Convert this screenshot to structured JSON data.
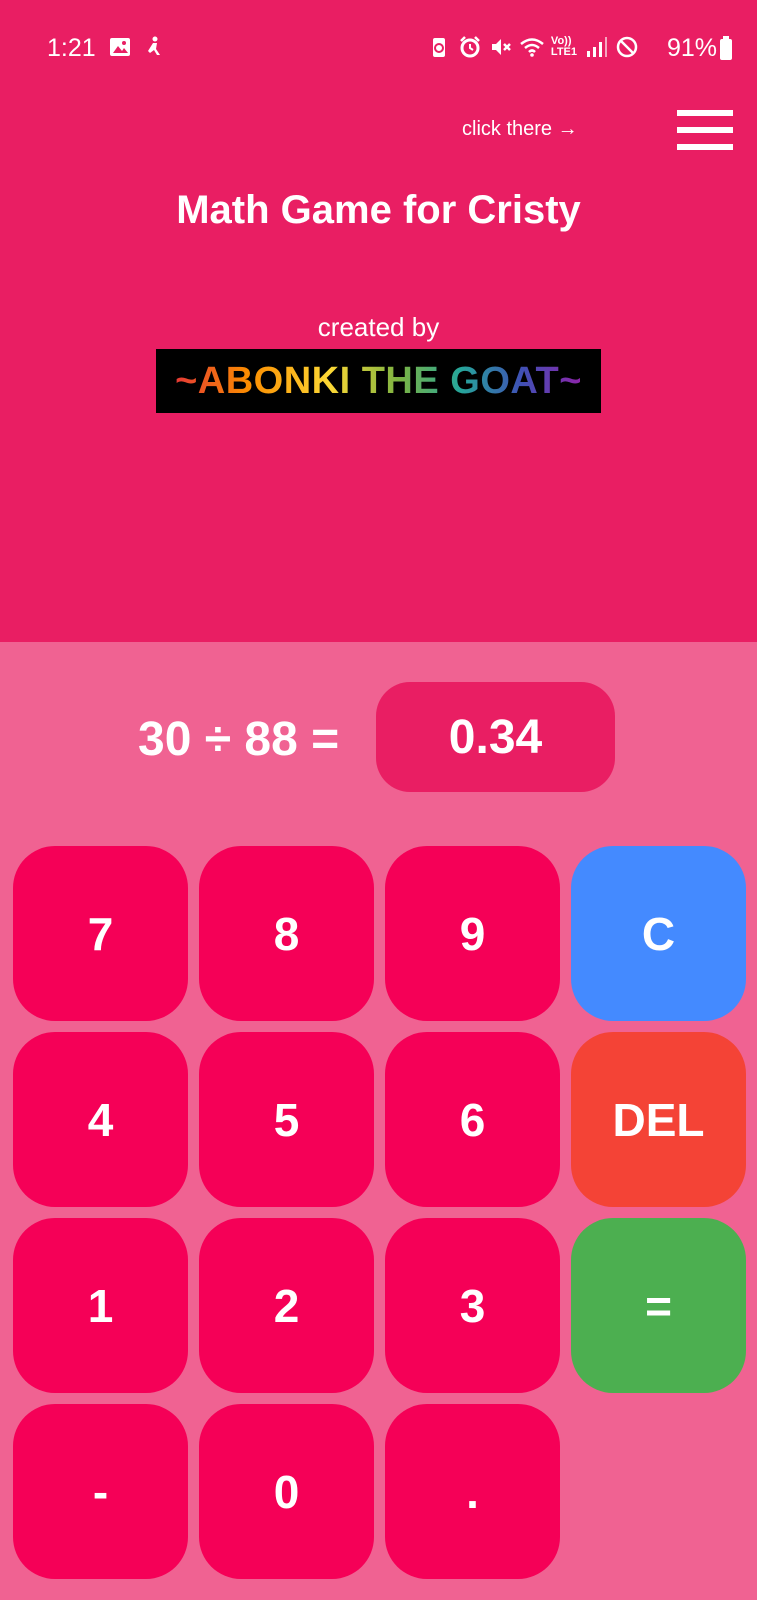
{
  "status_bar": {
    "time": "1:21",
    "battery": "91%",
    "left_icons": [
      "gallery-icon",
      "accessibility-icon"
    ],
    "right_icons": [
      "battery-saver-icon",
      "alarm-icon",
      "mute-icon",
      "wifi-icon",
      "volte-icon",
      "signal-icon",
      "dnd-icon"
    ],
    "volte_label": "Vo))",
    "lte_label": "LTE1"
  },
  "header": {
    "hint": "click there →",
    "menu_icon": "hamburger-menu-icon",
    "title": "Math Game for Cristy",
    "created_by": "created by",
    "author": "~ABONKI THE GOAT~"
  },
  "question": {
    "text": "30 ÷ 88 =",
    "answer": "0.34"
  },
  "keypad": {
    "keys": [
      {
        "label": "7",
        "kind": "digit"
      },
      {
        "label": "8",
        "kind": "digit"
      },
      {
        "label": "9",
        "kind": "digit"
      },
      {
        "label": "C",
        "kind": "clear"
      },
      {
        "label": "4",
        "kind": "digit"
      },
      {
        "label": "5",
        "kind": "digit"
      },
      {
        "label": "6",
        "kind": "digit"
      },
      {
        "label": "DEL",
        "kind": "del"
      },
      {
        "label": "1",
        "kind": "digit"
      },
      {
        "label": "2",
        "kind": "digit"
      },
      {
        "label": "3",
        "kind": "digit"
      },
      {
        "label": "=",
        "kind": "eq"
      },
      {
        "label": "-",
        "kind": "digit"
      },
      {
        "label": "0",
        "kind": "digit"
      },
      {
        "label": ".",
        "kind": "digit"
      }
    ]
  },
  "colors": {
    "header_bg": "#e91e63",
    "body_bg": "#f06292",
    "key_bg": "#f50057",
    "clear_bg": "#448aff",
    "del_bg": "#f44336",
    "eq_bg": "#4caf50"
  }
}
